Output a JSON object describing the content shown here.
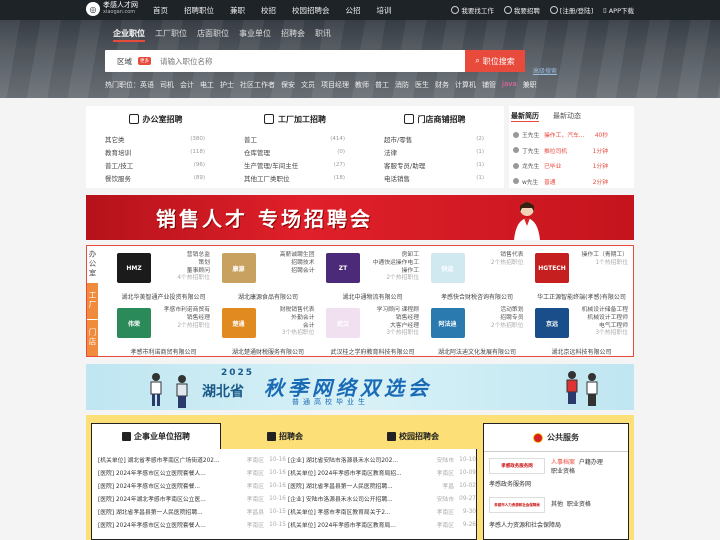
{
  "topbar": {
    "logo_main": "孝感人才网",
    "logo_sub": "xiaogan.com",
    "nav": [
      "首页",
      "招聘职位",
      "兼职",
      "校招",
      "校园招聘会",
      "公招",
      "培训"
    ],
    "find_job": "我要找工作",
    "recruit": "我要招聘",
    "login": "[注册/登陆]",
    "app": "APP下载"
  },
  "search": {
    "tabs": [
      "企业职位",
      "工厂职位",
      "店面职位",
      "事业单位",
      "招聘会",
      "职讯"
    ],
    "area": "区域",
    "more": "更多",
    "placeholder": "请输入职位名称",
    "button": "职位搜索",
    "advanced": "高级搜索"
  },
  "hot": {
    "label": "热门职位：",
    "items": [
      "英语",
      "司机",
      "会计",
      "电工",
      "护士",
      "社区工作者",
      "保安",
      "文员",
      "项目经理",
      "教师",
      "普工",
      "消防",
      "医生",
      "财务",
      "计算机",
      "铺管",
      "java",
      "兼职"
    ]
  },
  "categories": [
    {
      "title": "办公室招聘",
      "rows": [
        [
          "其它类",
          "(380)"
        ],
        [
          "教育培训",
          "(118)"
        ],
        [
          "普工/技工",
          "(96)"
        ],
        [
          "餐饮服务",
          "(89)"
        ]
      ]
    },
    {
      "title": "工厂加工招聘",
      "rows": [
        [
          "普工",
          "(414)"
        ],
        [
          "仓库管理",
          "(0)"
        ],
        [
          "生产管理/车间主任",
          "(27)"
        ],
        [
          "其他工厂类职位",
          "(18)"
        ]
      ]
    },
    {
      "title": "门店商铺招聘",
      "rows": [
        [
          "超市/零售",
          "(2)"
        ],
        [
          "法律",
          "(1)"
        ],
        [
          "客服专员/助理",
          "(1)"
        ],
        [
          "电话销售",
          "(1)"
        ]
      ]
    }
  ],
  "news": {
    "tabs": [
      "最新简历",
      "最新动态"
    ],
    "rows": [
      [
        "王先生",
        "操作工，汽车...",
        "40秒"
      ],
      [
        "丁先生",
        "推拉司机",
        "1分钟"
      ],
      [
        "龙先生",
        "已毕业",
        "1分钟"
      ],
      [
        "w先生",
        "普通",
        "2分钟"
      ]
    ]
  },
  "banner1": {
    "text": "销售人才 专场招聘会"
  },
  "companies": {
    "side": [
      "办公室",
      "工厂",
      "门店"
    ],
    "items": [
      {
        "logo": "HMZ",
        "color": "#1b1b1b",
        "jobs": [
          "营销总监",
          "策划",
          "董事顾问"
        ],
        "more": "4个热招职位",
        "name": "湖北华美智通产业投资有限公司"
      },
      {
        "logo": "康源",
        "color": "#c8a060",
        "jobs": [
          "高薪诚聘生团",
          "招聘技术",
          "招聘会计"
        ],
        "more": "",
        "name": "湖北康源食品有限公司"
      },
      {
        "logo": "ZT",
        "color": "#4b2a7a",
        "jobs": [
          "房卸工",
          "中通快运操作电工",
          "操作工"
        ],
        "more": "2个热招职位",
        "name": "湖北中通物流有限公司"
      },
      {
        "logo": "快运",
        "color": "#d0e8f0",
        "jobs": [
          "销售代表"
        ],
        "more": "2个热招职位",
        "name": "孝感快合财税咨询有限公司"
      },
      {
        "logo": "HGTECH",
        "color": "#c51f1f",
        "jobs": [
          "操作工（青期工）"
        ],
        "more": "1个热招职位",
        "name": "华工正源智能终端(孝感)有限公司"
      },
      {
        "logo": "伟荣",
        "color": "#2b8a5a",
        "jobs": [
          "孝感市利诺商贸有",
          "销售经理"
        ],
        "more": "2个热招职位",
        "name": "孝感市利诺商贸有限公司"
      },
      {
        "logo": "楚通",
        "color": "#e08a20",
        "jobs": [
          "财税销售代表",
          "外勤会计",
          "会计"
        ],
        "more": "3个热招职位",
        "name": "湖北楚通财税服务有限公司"
      },
      {
        "logo": "武汉",
        "color": "#f0e0f0",
        "jobs": [
          "学习顾问 课程顾",
          "销售经理",
          "大客户经理"
        ],
        "more": "3个热招职位",
        "name": "武汉桂之学府教育科技有限公司"
      },
      {
        "logo": "阿法迪",
        "color": "#2a7ab0",
        "jobs": [
          "活动策划",
          "招聘专员"
        ],
        "more": "2个热招职位",
        "name": "湖北阿法迪文化发展有限公司"
      },
      {
        "logo": "京远",
        "color": "#1a4e8a",
        "jobs": [
          "机械设计储备工程",
          "机械设计工程师",
          "电气工程师"
        ],
        "more": "3个热招职位",
        "name": "湖北京远科技有限公司"
      }
    ]
  },
  "banner2": {
    "year": "2025",
    "province": "湖北省",
    "title": "秋季网络双选会",
    "subtitle": "普通高校毕业生"
  },
  "lower": {
    "tabs": [
      "企事业单位招聘",
      "招聘会",
      "校园招聘会"
    ],
    "left": [
      [
        "[机关单位] 湖北省孝感市孝南区广场街道202...",
        "孝南区",
        "10-16"
      ],
      [
        "[医院] 2024年孝感市区公立医院套餐人...",
        "孝南区",
        "10-16"
      ],
      [
        "[医院] 2024年孝感市区公立医院套餐...",
        "孝南区",
        "10-16"
      ],
      [
        "[医院] 2024年湖北孝感市孝南区公立医...",
        "孝南区",
        "10-16"
      ],
      [
        "[医院] 湖北省孝昌县第一人民医院招聘...",
        "孝昌县",
        "10-15"
      ],
      [
        "[医院] 2024年孝感市区公立医院套餐人...",
        "孝南区",
        "10-15"
      ]
    ],
    "right": [
      [
        "[企业] 湖北省安陆市洛源县禾水公司202...",
        "安陆市",
        "10-10"
      ],
      [
        "[机关单位] 2024年孝感市孝南区教育局招...",
        "孝南区",
        "10-09"
      ],
      [
        "[医院] 湖北省孝昌县第一人民医院招聘...",
        "孝昌",
        "10-02"
      ],
      [
        "[企业] 安陆市洛源县禾水公司公开招聘...",
        "安陆市",
        "09-27"
      ],
      [
        "[机关单位] 孝感市孝南区教育局关于2...",
        "孝南区",
        "9-30"
      ],
      [
        "[机关单位] 2024年孝感市孝南区教育局...",
        "孝南区",
        "9-26"
      ]
    ],
    "services": {
      "title": "公共服务",
      "logo1": "孝感政务服务网",
      "links1": [
        "人事档案",
        "户籍办理",
        "职业资格"
      ],
      "name1": "孝感政务服务网",
      "logo2": "孝感市人力资源和社会保障局",
      "links2": [
        "其他",
        "职业资格"
      ],
      "name2": "孝感人力资源和社会保障局"
    }
  },
  "colors": {
    "accent": "#e84a3c",
    "topbar": "#1e2328",
    "orange": "#f08a3c",
    "yellow": "#fce077"
  }
}
